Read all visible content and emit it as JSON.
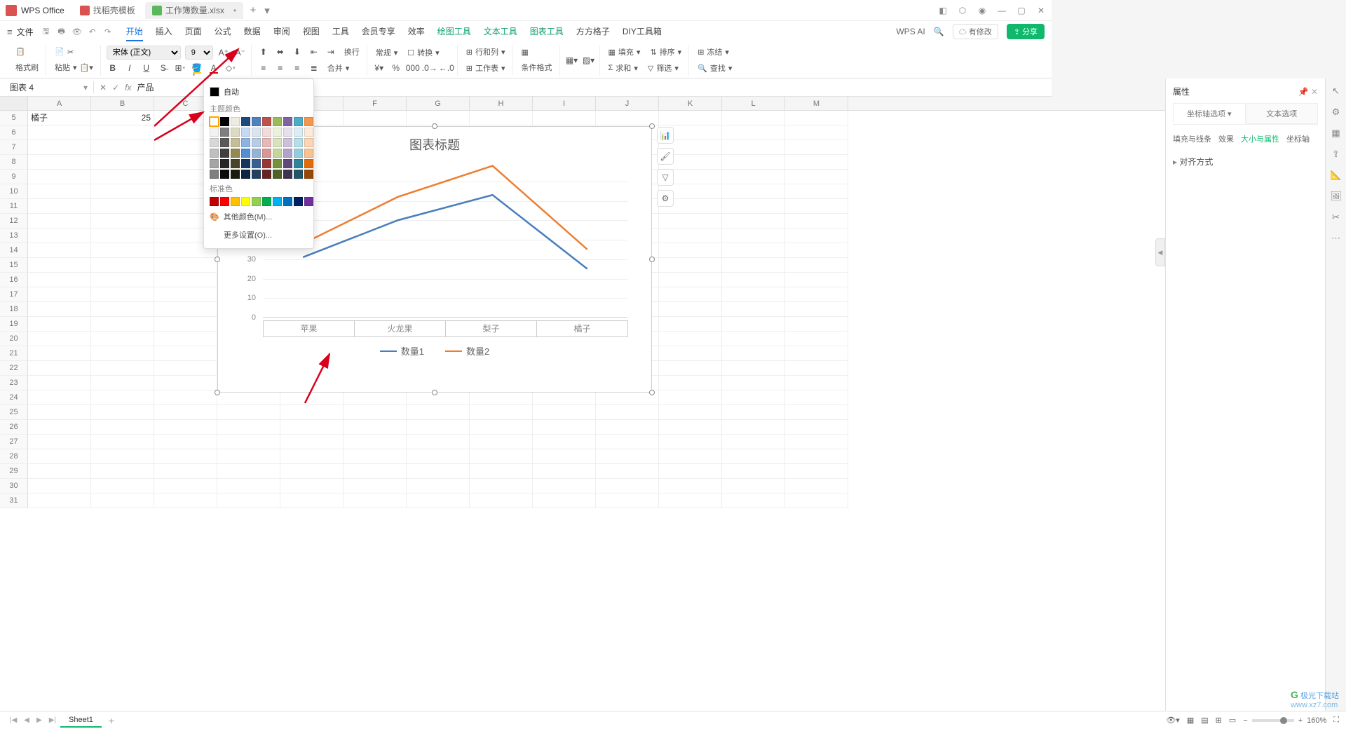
{
  "app": {
    "name": "WPS Office"
  },
  "tabs": [
    {
      "label": "找稻壳模板",
      "icon": "red"
    },
    {
      "label": "工作簿数量.xlsx",
      "icon": "green",
      "active": true
    }
  ],
  "menu": {
    "file": "文件",
    "items": [
      "开始",
      "插入",
      "页面",
      "公式",
      "数据",
      "审阅",
      "视图",
      "工具",
      "会员专享",
      "效率"
    ],
    "tool_items": [
      "绘图工具",
      "文本工具",
      "图表工具",
      "方方格子",
      "DIY工具箱"
    ],
    "ai": "WPS AI",
    "cloud": "有修改",
    "share": "分享"
  },
  "ribbon": {
    "format_painter": "格式刷",
    "paste": "粘贴",
    "font": "宋体 (正文)",
    "size": "9",
    "general": "常规",
    "convert": "转换",
    "rowcol": "行和列",
    "worksheet": "工作表",
    "cond": "条件格式",
    "fill": "填充",
    "sort": "排序",
    "sum": "求和",
    "filter": "筛选",
    "freeze": "冻结",
    "find": "查找",
    "merge": "合并",
    "wrap": "换行"
  },
  "namebox": {
    "value": "图表 4",
    "formula": "产品"
  },
  "columns": [
    "A",
    "B",
    "C",
    "D",
    "E",
    "F",
    "G",
    "H",
    "I",
    "J",
    "K",
    "L",
    "M"
  ],
  "first_row": 5,
  "cells": {
    "A5": "橘子",
    "B5": "25"
  },
  "color_menu": {
    "auto": "自动",
    "theme": "主题颜色",
    "standard": "标准色",
    "more": "其他颜色(M)...",
    "settings": "更多设置(O)...",
    "theme_colors": [
      [
        "#ffffff",
        "#000000",
        "#eeece1",
        "#1f497d",
        "#4f81bd",
        "#c0504d",
        "#9bbb59",
        "#8064a2",
        "#4bacc6",
        "#f79646"
      ],
      [
        "#f2f2f2",
        "#7f7f7f",
        "#ddd9c3",
        "#c6d9f0",
        "#dbe5f1",
        "#f2dcdb",
        "#ebf1dd",
        "#e5e0ec",
        "#dbeef3",
        "#fdeada"
      ],
      [
        "#d8d8d8",
        "#595959",
        "#c4bd97",
        "#8db3e2",
        "#b8cce4",
        "#e5b9b7",
        "#d7e3bc",
        "#ccc1d9",
        "#b7dde8",
        "#fbd5b5"
      ],
      [
        "#bfbfbf",
        "#3f3f3f",
        "#938953",
        "#548dd4",
        "#95b3d7",
        "#d99694",
        "#c3d69b",
        "#b2a2c7",
        "#92cddc",
        "#fac08f"
      ],
      [
        "#a5a5a5",
        "#262626",
        "#494429",
        "#17365d",
        "#366092",
        "#953734",
        "#76923c",
        "#5f497a",
        "#31859b",
        "#e36c09"
      ],
      [
        "#7f7f7f",
        "#0c0c0c",
        "#1d1b10",
        "#0f243e",
        "#244061",
        "#632423",
        "#4f6128",
        "#3f3151",
        "#205867",
        "#974806"
      ]
    ],
    "std_colors": [
      "#c00000",
      "#ff0000",
      "#ffc000",
      "#ffff00",
      "#92d050",
      "#00b050",
      "#00b0f0",
      "#0070c0",
      "#002060",
      "#7030a0"
    ]
  },
  "chart_data": {
    "type": "line",
    "title": "图表标题",
    "categories": [
      "苹果",
      "火龙果",
      "梨子",
      "橘子"
    ],
    "series": [
      {
        "name": "数量1",
        "color": "#4a7ebb",
        "values": [
          31,
          50,
          63,
          25
        ]
      },
      {
        "name": "数量2",
        "color": "#ed7d31",
        "values": [
          38,
          62,
          78,
          35
        ]
      }
    ],
    "ylim": [
      0,
      80
    ],
    "yticks": [
      0,
      10,
      20,
      30,
      40,
      50,
      60,
      70
    ]
  },
  "panel": {
    "title": "属性",
    "tab1": "坐标轴选项",
    "tab2": "文本选项",
    "cats": [
      "填充与线条",
      "效果",
      "大小与属性",
      "坐标轴"
    ],
    "section": "对齐方式"
  },
  "sheet": {
    "name": "Sheet1"
  },
  "status": {
    "zoom": "160%"
  },
  "watermark": {
    "site": "极光下载站",
    "url": "www.xz7.com"
  }
}
